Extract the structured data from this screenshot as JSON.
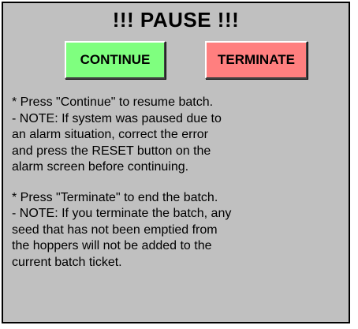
{
  "dialog": {
    "title": "!!! PAUSE !!!",
    "continue_label": "CONTINUE",
    "terminate_label": "TERMINATE",
    "colors": {
      "background": "#c0c0c0",
      "continue_button": "#7fff7f",
      "terminate_button": "#ff7f7f"
    }
  },
  "instructions": {
    "continue_lines": [
      "* Press \"Continue\" to resume batch.",
      "- NOTE: If system was paused due to",
      "an alarm situation, correct the error",
      "and press the RESET button on the",
      "alarm screen before continuing."
    ],
    "terminate_lines": [
      "* Press \"Terminate\" to end the batch.",
      "- NOTE: If you terminate the batch, any",
      "seed that has not been emptied from",
      "the hoppers will not be added to the",
      "current batch ticket."
    ]
  }
}
